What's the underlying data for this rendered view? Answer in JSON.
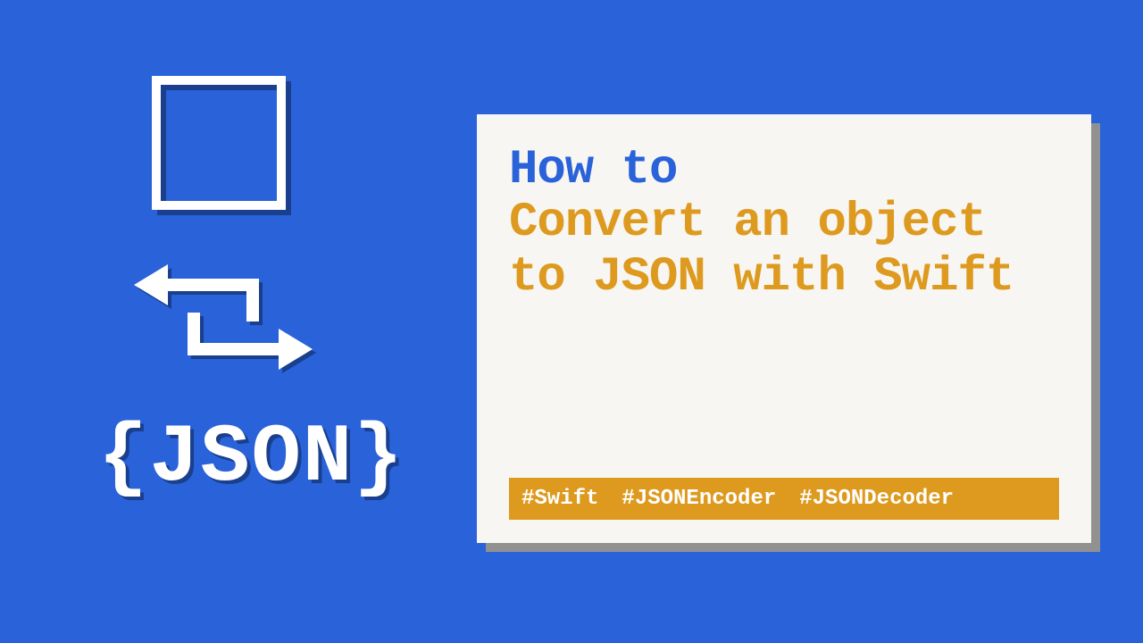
{
  "left": {
    "logo_text": "{JSON}"
  },
  "card": {
    "title_line1": "How to",
    "title_line2": "Convert an object to JSON with Swift",
    "tags": [
      "#Swift",
      "#JSONEncoder",
      "#JSONDecoder"
    ]
  },
  "colors": {
    "bg": "#2962d9",
    "accent": "#dd9a1f",
    "card_bg": "#f7f6f2",
    "shadow": "#919191"
  }
}
